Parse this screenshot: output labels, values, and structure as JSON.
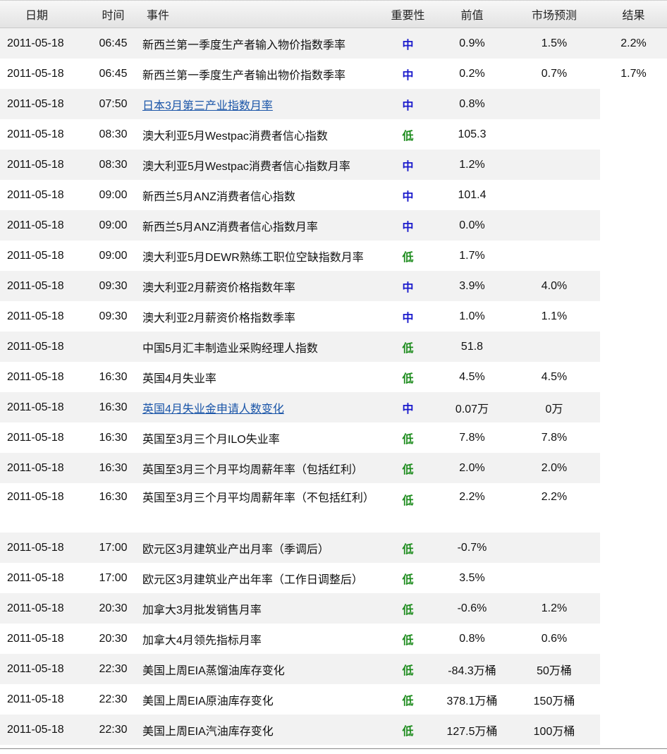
{
  "headers": {
    "date": "日期",
    "time": "时间",
    "event": "事件",
    "importance": "重要性",
    "previous": "前值",
    "forecast": "市场预测",
    "result": "结果"
  },
  "rows": [
    {
      "date": "2011-05-18",
      "time": "06:45",
      "event": "新西兰第一季度生产者输入物价指数季率",
      "importance": "中",
      "level": "mid",
      "previous": "0.9%",
      "forecast": "1.5%",
      "result": "2.2%",
      "link": false
    },
    {
      "date": "2011-05-18",
      "time": "06:45",
      "event": "新西兰第一季度生产者输出物价指数季率",
      "importance": "中",
      "level": "mid",
      "previous": "0.2%",
      "forecast": "0.7%",
      "result": "1.7%",
      "link": false
    },
    {
      "date": "2011-05-18",
      "time": "07:50",
      "event": "日本3月第三产业指数月率",
      "importance": "中",
      "level": "mid",
      "previous": "0.8%",
      "forecast": "",
      "result": "",
      "link": true
    },
    {
      "date": "2011-05-18",
      "time": "08:30",
      "event": "澳大利亚5月Westpac消费者信心指数",
      "importance": "低",
      "level": "low",
      "previous": "105.3",
      "forecast": "",
      "result": "",
      "link": false
    },
    {
      "date": "2011-05-18",
      "time": "08:30",
      "event": "澳大利亚5月Westpac消费者信心指数月率",
      "importance": "中",
      "level": "mid",
      "previous": "1.2%",
      "forecast": "",
      "result": "",
      "link": false
    },
    {
      "date": "2011-05-18",
      "time": "09:00",
      "event": "新西兰5月ANZ消费者信心指数",
      "importance": "中",
      "level": "mid",
      "previous": "101.4",
      "forecast": "",
      "result": "",
      "link": false
    },
    {
      "date": "2011-05-18",
      "time": "09:00",
      "event": "新西兰5月ANZ消费者信心指数月率",
      "importance": "中",
      "level": "mid",
      "previous": "0.0%",
      "forecast": "",
      "result": "",
      "link": false
    },
    {
      "date": "2011-05-18",
      "time": "09:00",
      "event": "澳大利亚5月DEWR熟练工职位空缺指数月率",
      "importance": "低",
      "level": "low",
      "previous": "1.7%",
      "forecast": "",
      "result": "",
      "link": false
    },
    {
      "date": "2011-05-18",
      "time": "09:30",
      "event": "澳大利亚2月薪资价格指数年率",
      "importance": "中",
      "level": "mid",
      "previous": "3.9%",
      "forecast": "4.0%",
      "result": "",
      "link": false
    },
    {
      "date": "2011-05-18",
      "time": "09:30",
      "event": "澳大利亚2月薪资价格指数季率",
      "importance": "中",
      "level": "mid",
      "previous": "1.0%",
      "forecast": "1.1%",
      "result": "",
      "link": false
    },
    {
      "date": "2011-05-18",
      "time": "",
      "event": "中国5月汇丰制造业采购经理人指数",
      "importance": "低",
      "level": "low",
      "previous": "51.8",
      "forecast": "",
      "result": "",
      "link": false
    },
    {
      "date": "2011-05-18",
      "time": "16:30",
      "event": "英国4月失业率",
      "importance": "低",
      "level": "low",
      "previous": "4.5%",
      "forecast": "4.5%",
      "result": "",
      "link": false
    },
    {
      "date": "2011-05-18",
      "time": "16:30",
      "event": "英国4月失业金申请人数变化",
      "importance": "中",
      "level": "mid",
      "previous": "0.07万",
      "forecast": "0万",
      "result": "",
      "link": true
    },
    {
      "date": "2011-05-18",
      "time": "16:30",
      "event": "英国至3月三个月ILO失业率",
      "importance": "低",
      "level": "low",
      "previous": "7.8%",
      "forecast": "7.8%",
      "result": "",
      "link": false
    },
    {
      "date": "2011-05-18",
      "time": "16:30",
      "event": "英国至3月三个月平均周薪年率（包括红利）",
      "importance": "低",
      "level": "low",
      "previous": "2.0%",
      "forecast": "2.0%",
      "result": "",
      "link": false
    },
    {
      "date": "2011-05-18",
      "time": "16:30",
      "event": "英国至3月三个月平均周薪年率（不包括红利）",
      "importance": "低",
      "level": "low",
      "previous": "2.2%",
      "forecast": "2.2%",
      "result": "",
      "link": false
    },
    {
      "date": "2011-05-18",
      "time": "17:00",
      "event": "欧元区3月建筑业产出月率（季调后）",
      "importance": "低",
      "level": "low",
      "previous": "-0.7%",
      "forecast": "",
      "result": "",
      "link": false
    },
    {
      "date": "2011-05-18",
      "time": "17:00",
      "event": "欧元区3月建筑业产出年率（工作日调整后）",
      "importance": "低",
      "level": "low",
      "previous": "3.5%",
      "forecast": "",
      "result": "",
      "link": false
    },
    {
      "date": "2011-05-18",
      "time": "20:30",
      "event": "加拿大3月批发销售月率",
      "importance": "低",
      "level": "low",
      "previous": "-0.6%",
      "forecast": "1.2%",
      "result": "",
      "link": false
    },
    {
      "date": "2011-05-18",
      "time": "20:30",
      "event": "加拿大4月领先指标月率",
      "importance": "低",
      "level": "low",
      "previous": "0.8%",
      "forecast": "0.6%",
      "result": "",
      "link": false
    },
    {
      "date": "2011-05-18",
      "time": "22:30",
      "event": "美国上周EIA蒸馏油库存变化",
      "importance": "低",
      "level": "low",
      "previous": "-84.3万桶",
      "forecast": "50万桶",
      "result": "",
      "link": false
    },
    {
      "date": "2011-05-18",
      "time": "22:30",
      "event": "美国上周EIA原油库存变化",
      "importance": "低",
      "level": "low",
      "previous": "378.1万桶",
      "forecast": "150万桶",
      "result": "",
      "link": false
    },
    {
      "date": "2011-05-18",
      "time": "22:30",
      "event": "美国上周EIA汽油库存变化",
      "importance": "低",
      "level": "low",
      "previous": "127.5万桶",
      "forecast": "100万桶",
      "result": "",
      "link": false
    }
  ]
}
